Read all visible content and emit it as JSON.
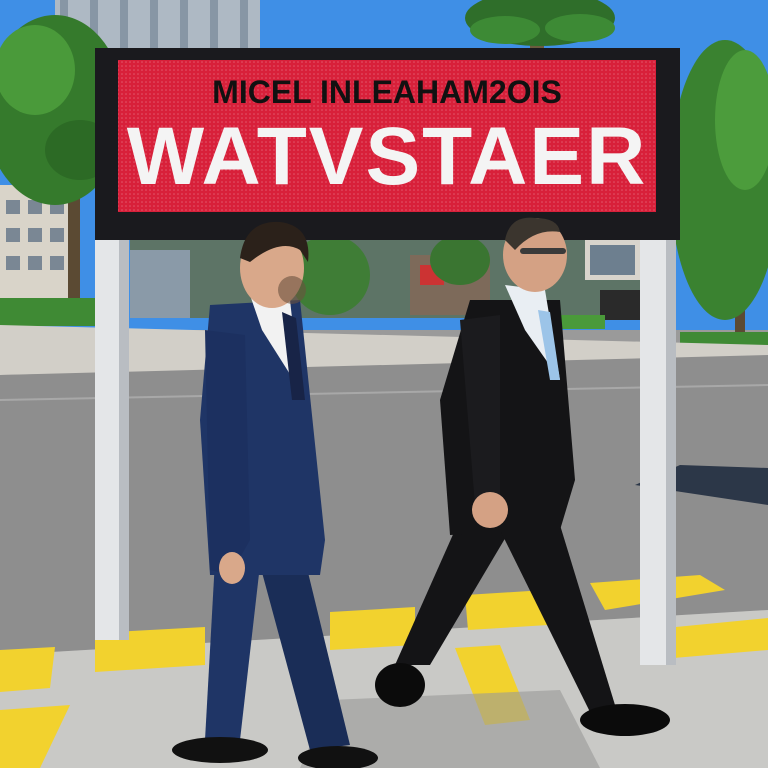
{
  "sign": {
    "top_line": "MICEL INLEAHAM2OIS",
    "main_line": "WATVSTAER",
    "panel_color": "#d8203a"
  },
  "palette": {
    "sky": "#3f8fe6",
    "road": "#8e8e8e",
    "sidewalk": "#c9c9c6",
    "curb_yellow": "#f2d22e",
    "navy_suit": "#1f3566",
    "black_suit": "#141416"
  }
}
